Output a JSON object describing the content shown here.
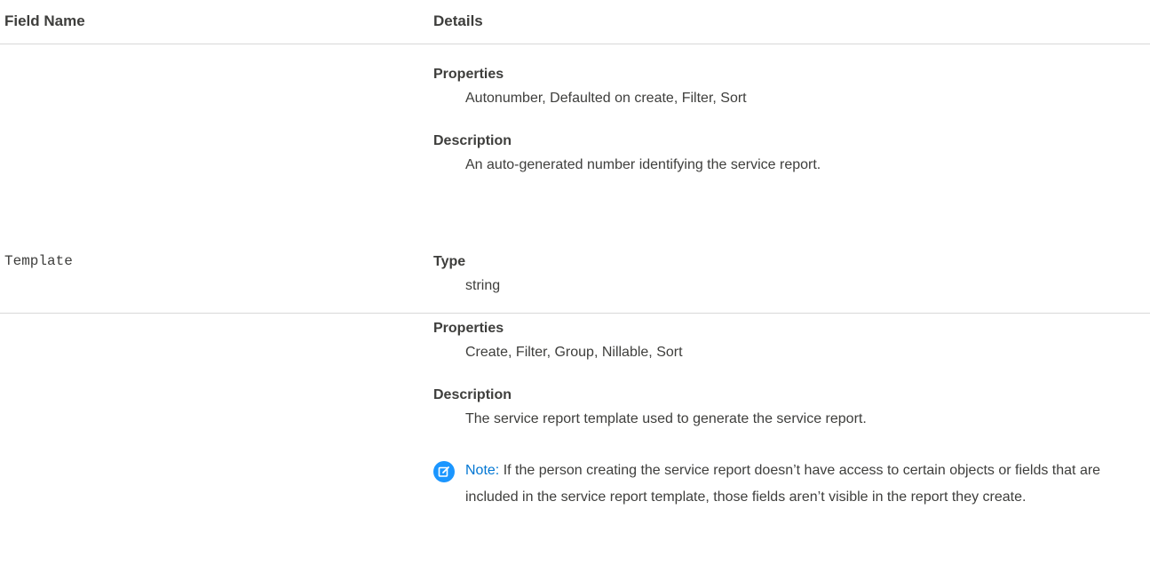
{
  "table": {
    "headers": {
      "field_name": "Field Name",
      "details": "Details"
    },
    "rows": [
      {
        "field_name": "",
        "properties_label": "Properties",
        "properties_value": "Autonumber, Defaulted on create, Filter, Sort",
        "description_label": "Description",
        "description_value": "An auto-generated number identifying the service report."
      },
      {
        "field_name": "Template",
        "type_label": "Type",
        "type_value": "string",
        "properties_label": "Properties",
        "properties_value": "Create, Filter, Group, Nillable, Sort",
        "description_label": "Description",
        "description_value": "The service report template used to generate the service report.",
        "note_label": "Note:",
        "note_text": "If the person creating the service report doesn’t have access to certain objects or fields that are included in the service report template, those fields aren’t visible in the report they create.",
        "note_icon": "edit-note-icon"
      }
    ]
  },
  "colors": {
    "text": "#3e3e3c",
    "note_accent": "#1b96ff",
    "divider": "#d8d8d8"
  }
}
